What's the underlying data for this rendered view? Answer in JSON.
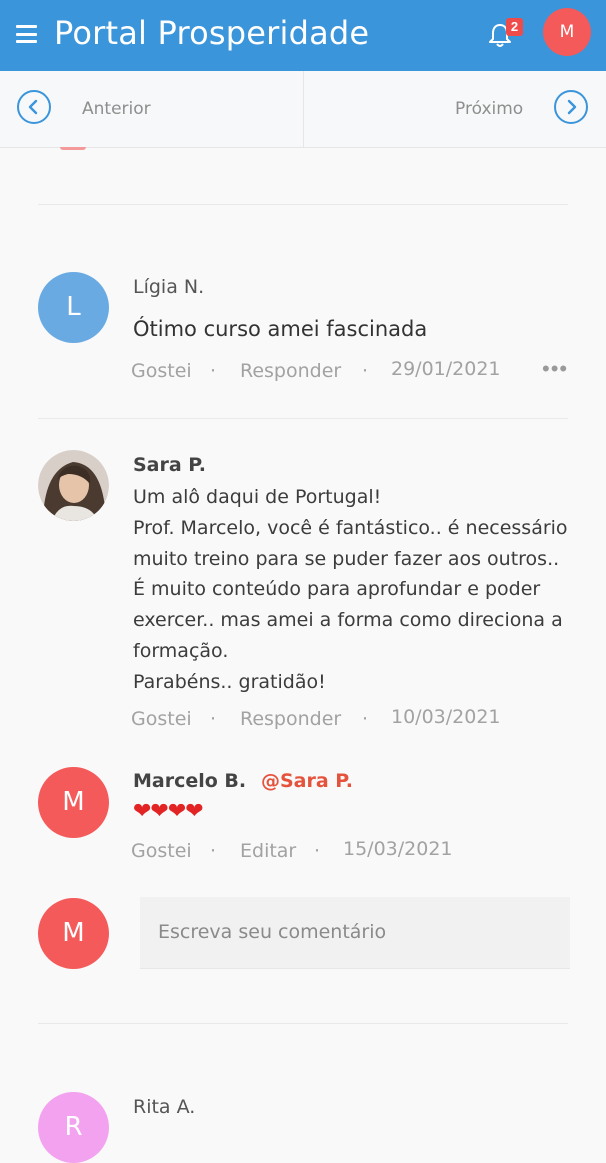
{
  "header": {
    "title": "Portal Prosperidade",
    "notification_count": "2",
    "user_initial": "M",
    "menu_icon": "hamburger-icon",
    "bell_icon": "bell-icon",
    "colors": {
      "bar": "#3b95db",
      "badge": "#ef4b4b",
      "avatar": "#f45a5a"
    }
  },
  "nav": {
    "prev_label": "Anterior",
    "next_label": "Próximo",
    "prev_icon": "chevron-left-icon",
    "next_icon": "chevron-right-icon"
  },
  "comments": [
    {
      "initial": "L",
      "author": "Lígia N.",
      "text": "Ótimo curso amei fascinada",
      "like": "Gostei",
      "reply": "Responder",
      "date": "29/01/2021",
      "more_icon": "more-horizontal-icon"
    },
    {
      "author": "Sara P.",
      "lines": [
        "Um alô daqui de Portugal!",
        "Prof. Marcelo, você é fantástico.. é necessário",
        "muito treino para se puder fazer aos outros..",
        "É muito conteúdo para aprofundar e poder",
        "exercer.. mas amei a forma como direciona a",
        "formação.",
        "Parabéns.. gratidão!"
      ],
      "like": "Gostei",
      "reply": "Responder",
      "date": "10/03/2021",
      "replies": [
        {
          "initial": "M",
          "author": "Marcelo B.",
          "mention": "@Sara P.",
          "text": "❤❤❤❤",
          "like": "Gostei",
          "edit": "Editar",
          "date": "15/03/2021"
        }
      ]
    },
    {
      "initial": "R",
      "author": "Rita A."
    }
  ],
  "composer": {
    "initial": "M",
    "placeholder": "Escreva seu comentário"
  },
  "separator": "·"
}
